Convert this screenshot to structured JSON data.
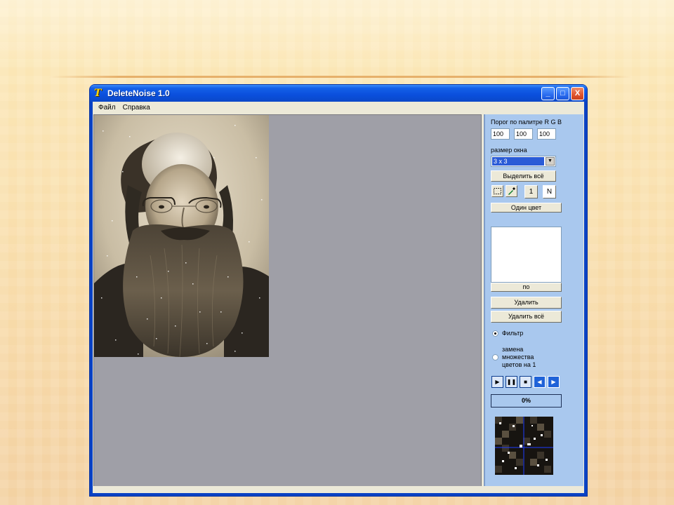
{
  "window": {
    "title": "DeleteNoise 1.0",
    "app_icon": "T",
    "controls": [
      "_",
      "□",
      "X"
    ]
  },
  "menu": {
    "items": [
      "Файл",
      "Справка"
    ]
  },
  "panel": {
    "threshold_label": "Порог по палитре R G B",
    "thresholds": [
      "100",
      "100",
      "100"
    ],
    "window_size_label": "размер окна",
    "window_size_value": "3 x 3",
    "select_all_label": "Выделить всё",
    "tool_one_label": "1",
    "tool_n_label": "N",
    "one_color_label": "Один цвет",
    "list_button_label": "по",
    "delete_label": "Удалить",
    "delete_all_label": "Удалить всё",
    "mode_filter_label": "Фильтр",
    "mode_replace_label": "замена множества цветов на 1",
    "mode_selected": "filter",
    "progress_text": "0%",
    "progress_value": 0
  },
  "icons": {
    "select_rect": "selection-rect-icon",
    "eyedropper": "eyedropper-icon",
    "play": "play-icon",
    "pause": "pause-icon",
    "stop": "stop-icon",
    "back": "back-arrow-icon",
    "forward": "forward-arrow-icon"
  }
}
